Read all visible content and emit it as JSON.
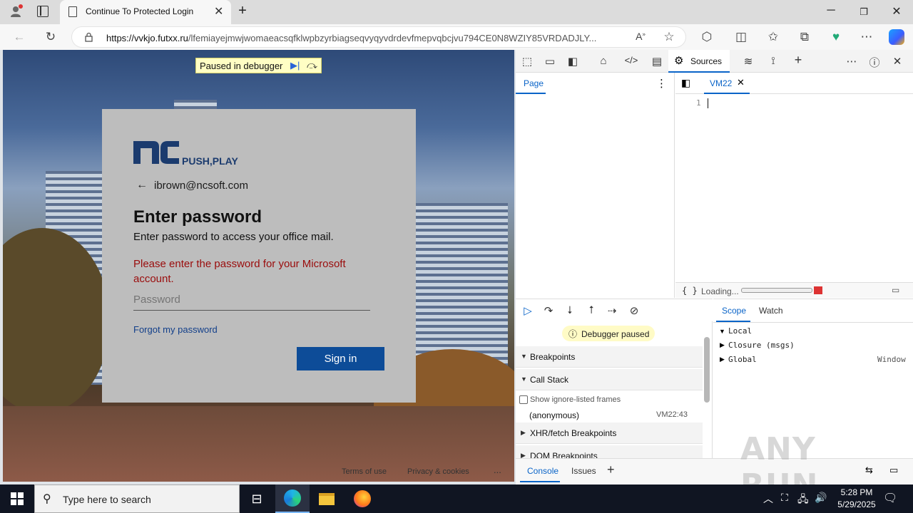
{
  "browser": {
    "tab_title": "Continue To Protected Login",
    "url_host": "https://vvkjo.futxx.ru",
    "url_path": "/lfemiayejmwjwomaeacsqfklwpbzyrbiagseqvyqyvdrdevfmepvqbcjvu794CE0N8WZIY85VRDADJLY..."
  },
  "page": {
    "paused_banner": "Paused in debugger",
    "logo_text": "PUSH,PLAY",
    "logo_mark": "nc",
    "email": "ibrown@ncsoft.com",
    "heading": "Enter password",
    "subtitle": "Enter password to access your office mail.",
    "error": "Please enter the password for your Microsoft account.",
    "password_placeholder": "Password",
    "forgot_link": "Forgot my password",
    "signin_button": "Sign in",
    "footer": {
      "terms": "Terms of use",
      "privacy": "Privacy & cookies",
      "more": "..."
    }
  },
  "devtools": {
    "sources_tab": "Sources",
    "nav_tab": "Page",
    "file_tab": "VM22",
    "line_number": "1",
    "loading": "Loading...",
    "format_icon": "{ }",
    "debugger_paused": "Debugger paused",
    "sections": {
      "breakpoints": "Breakpoints",
      "call_stack": "Call Stack",
      "show_ignore": "Show ignore-listed frames",
      "frame_name": "(anonymous)",
      "frame_loc": "VM22:43",
      "xhr": "XHR/fetch Breakpoints",
      "dom": "DOM Breakpoints"
    },
    "scope_tabs": {
      "scope": "Scope",
      "watch": "Watch"
    },
    "scope_items": {
      "local": "Local",
      "closure": "Closure (msgs)",
      "global": "Global",
      "global_val": "Window"
    },
    "drawer_tabs": {
      "console": "Console",
      "issues": "Issues"
    }
  },
  "taskbar": {
    "search_placeholder": "Type here to search",
    "time": "5:28 PM",
    "date": "5/29/2025"
  },
  "watermark": "ANY RUN"
}
